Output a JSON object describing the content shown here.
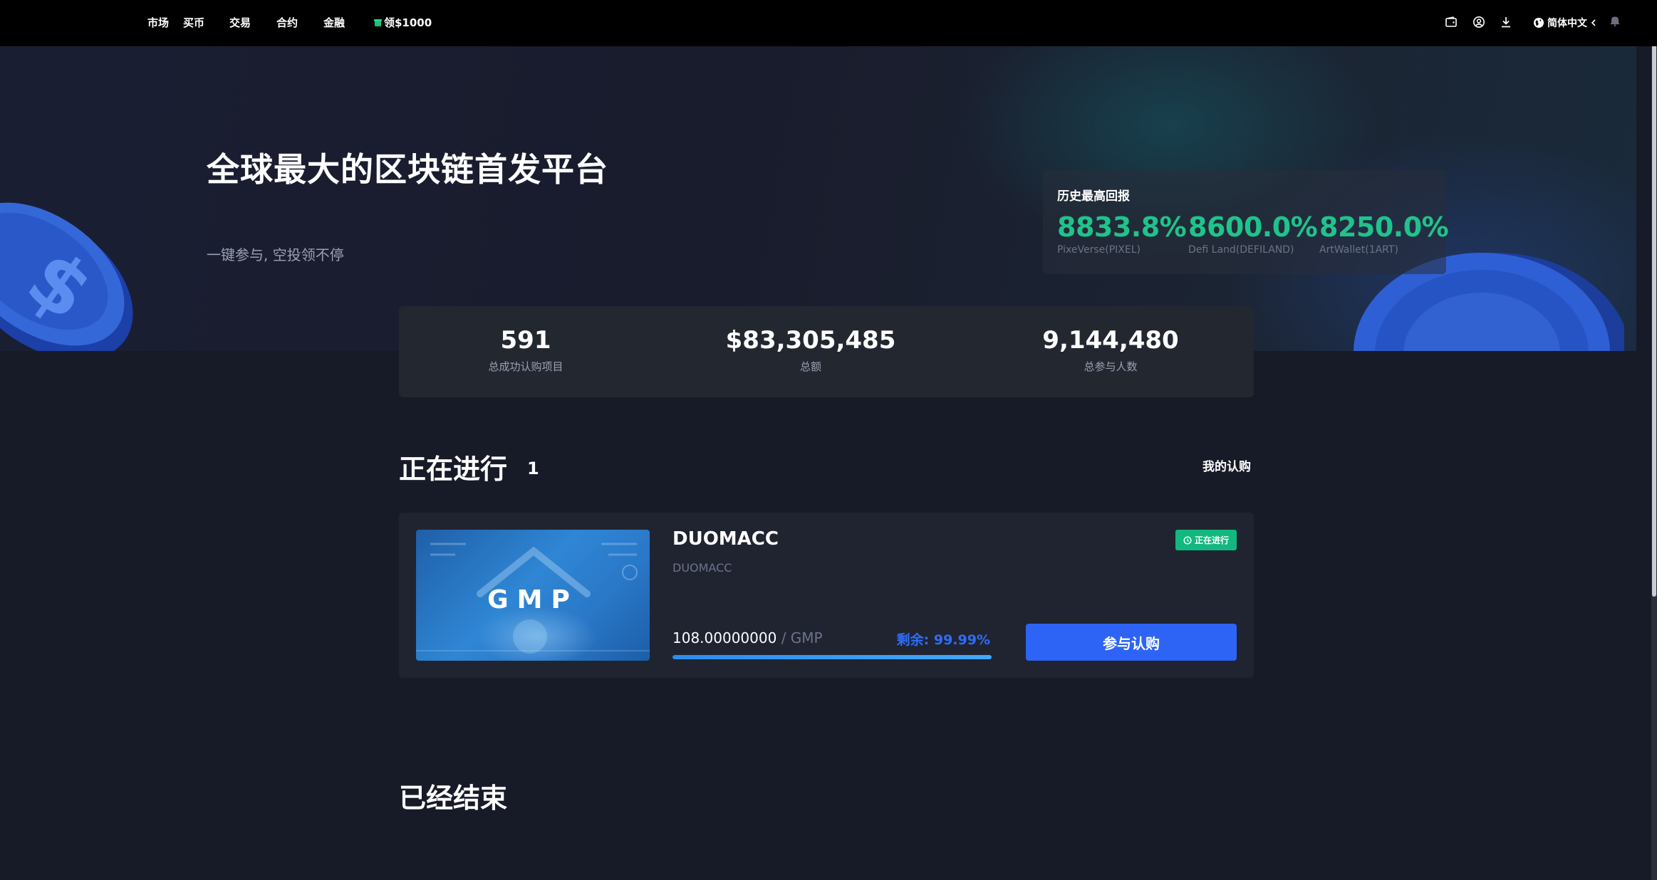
{
  "nav": {
    "items": [
      {
        "label": "市场"
      },
      {
        "label": "买币"
      },
      {
        "label": "交易"
      },
      {
        "label": "合约"
      },
      {
        "label": "金融"
      }
    ],
    "promo_label": "领$1000",
    "language_label": "简体中文",
    "icons": [
      "wallet-icon",
      "user-icon",
      "download-icon",
      "globe-icon",
      "bell-icon"
    ]
  },
  "hero": {
    "title": "全球最大的区块链首发平台",
    "subtitle": "一键参与, 空投领不停"
  },
  "returns": {
    "title": "历史最高回报",
    "items": [
      {
        "value": "8833.8%",
        "label": "PixeVerse(PIXEL)"
      },
      {
        "value": "8600.0%",
        "label": "Defi Land(DEFILAND)"
      },
      {
        "value": "8250.0%",
        "label": "ArtWallet(1ART)"
      }
    ]
  },
  "stats": [
    {
      "value": "591",
      "label": "总成功认购项目"
    },
    {
      "value": "$83,305,485",
      "label": "总额"
    },
    {
      "value": "9,144,480",
      "label": "总参与人数"
    }
  ],
  "ongoing": {
    "title": "正在进行",
    "count": "1",
    "my_subscriptions_label": "我的认购"
  },
  "project": {
    "image_text": "GMP",
    "name": "DUOMACC",
    "subtitle": "DUOMACC",
    "status": "正在进行",
    "amount": "108.00000000",
    "unit": "/ GMP",
    "remaining_label": "剩余:",
    "remaining_value": "99.99%",
    "progress_percent": 99.99,
    "button_label": "参与认购"
  },
  "ended": {
    "title": "已经结束"
  },
  "colors": {
    "accent_green": "#1fc38c",
    "accent_blue": "#2d64f6",
    "background": "#171a27"
  }
}
